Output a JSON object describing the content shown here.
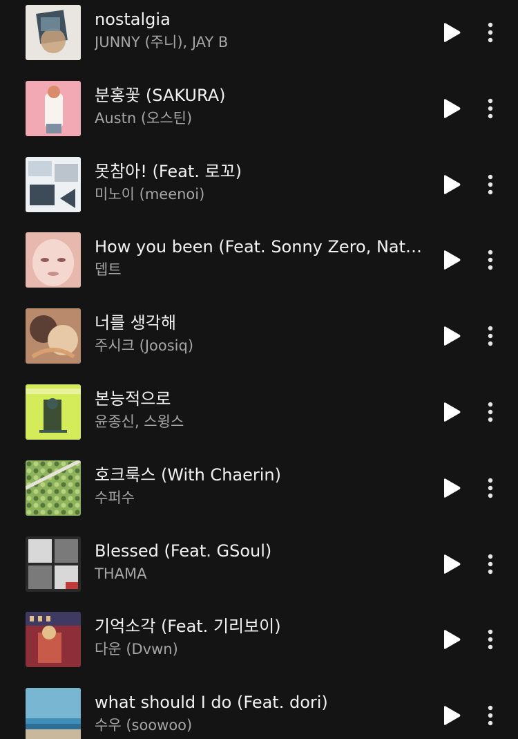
{
  "songs": [
    {
      "title": "nostalgia",
      "artist": "JUNNY (주니), JAY B",
      "art": "art-nostalgia",
      "colors": [
        "#e9e6e2",
        "#6f8a9a",
        "#c9a27a",
        "#40505c"
      ]
    },
    {
      "title": "분홍꽃 (SAKURA)",
      "artist": "Austn (오스틴)",
      "art": "art-sakura",
      "colors": [
        "#f2a9b4",
        "#f7f4ef",
        "#7e8fa4",
        "#d98b6c"
      ]
    },
    {
      "title": "못참아! (Feat. 로꼬)",
      "artist": "미노이 (meenoi)",
      "art": "art-mot",
      "colors": [
        "#eef1f3",
        "#9aa7b4",
        "#3d4a58",
        "#c8d2dc"
      ]
    },
    {
      "title": "How you been (Feat. Sonny Zero, Nath…",
      "artist": "뎁트",
      "art": "art-howyoubeen",
      "colors": [
        "#e6b8ae",
        "#f4d7cf",
        "#8e5b57",
        "#c98f88"
      ]
    },
    {
      "title": "너를 생각해",
      "artist": "주시크 (Joosiq)",
      "art": "art-joosiq",
      "colors": [
        "#b98a6c",
        "#e7c9a8",
        "#5b3e34",
        "#d6a06f"
      ]
    },
    {
      "title": "본능적으로",
      "artist": "윤종신, 스윙스",
      "art": "art-yoon",
      "colors": [
        "#d4ec5a",
        "#3f5a52",
        "#e8f39c",
        "#21322e"
      ]
    },
    {
      "title": "호크룩스 (With Chaerin)",
      "artist": "수퍼수",
      "art": "art-horcrux",
      "colors": [
        "#8cb35c",
        "#b7d27c",
        "#57763a",
        "#e6e3d8"
      ]
    },
    {
      "title": "Blessed (Feat. GSoul)",
      "artist": "THAMA",
      "art": "art-blessed",
      "colors": [
        "#d8d8d8",
        "#7a7a7a",
        "#2a2a2a",
        "#c23b3b"
      ]
    },
    {
      "title": "기억소각 (Feat. 기리보이)",
      "artist": "다운 (Dvwn)",
      "art": "art-dvwn",
      "colors": [
        "#8e2e39",
        "#e3c08a",
        "#3f3a62",
        "#c85a4a"
      ]
    },
    {
      "title": "what should I do (Feat. dori)",
      "artist": "수우 (soowoo)",
      "art": "art-soowoo",
      "colors": [
        "#3f8fb8",
        "#78b6d2",
        "#c9b89c",
        "#2d6f97"
      ]
    }
  ],
  "icons": {
    "play": "play-icon",
    "more": "more-vert-icon"
  },
  "theme": {
    "background": "#141414",
    "title_color": "#f2f2f2",
    "subtitle_color": "#a6a6a6"
  }
}
